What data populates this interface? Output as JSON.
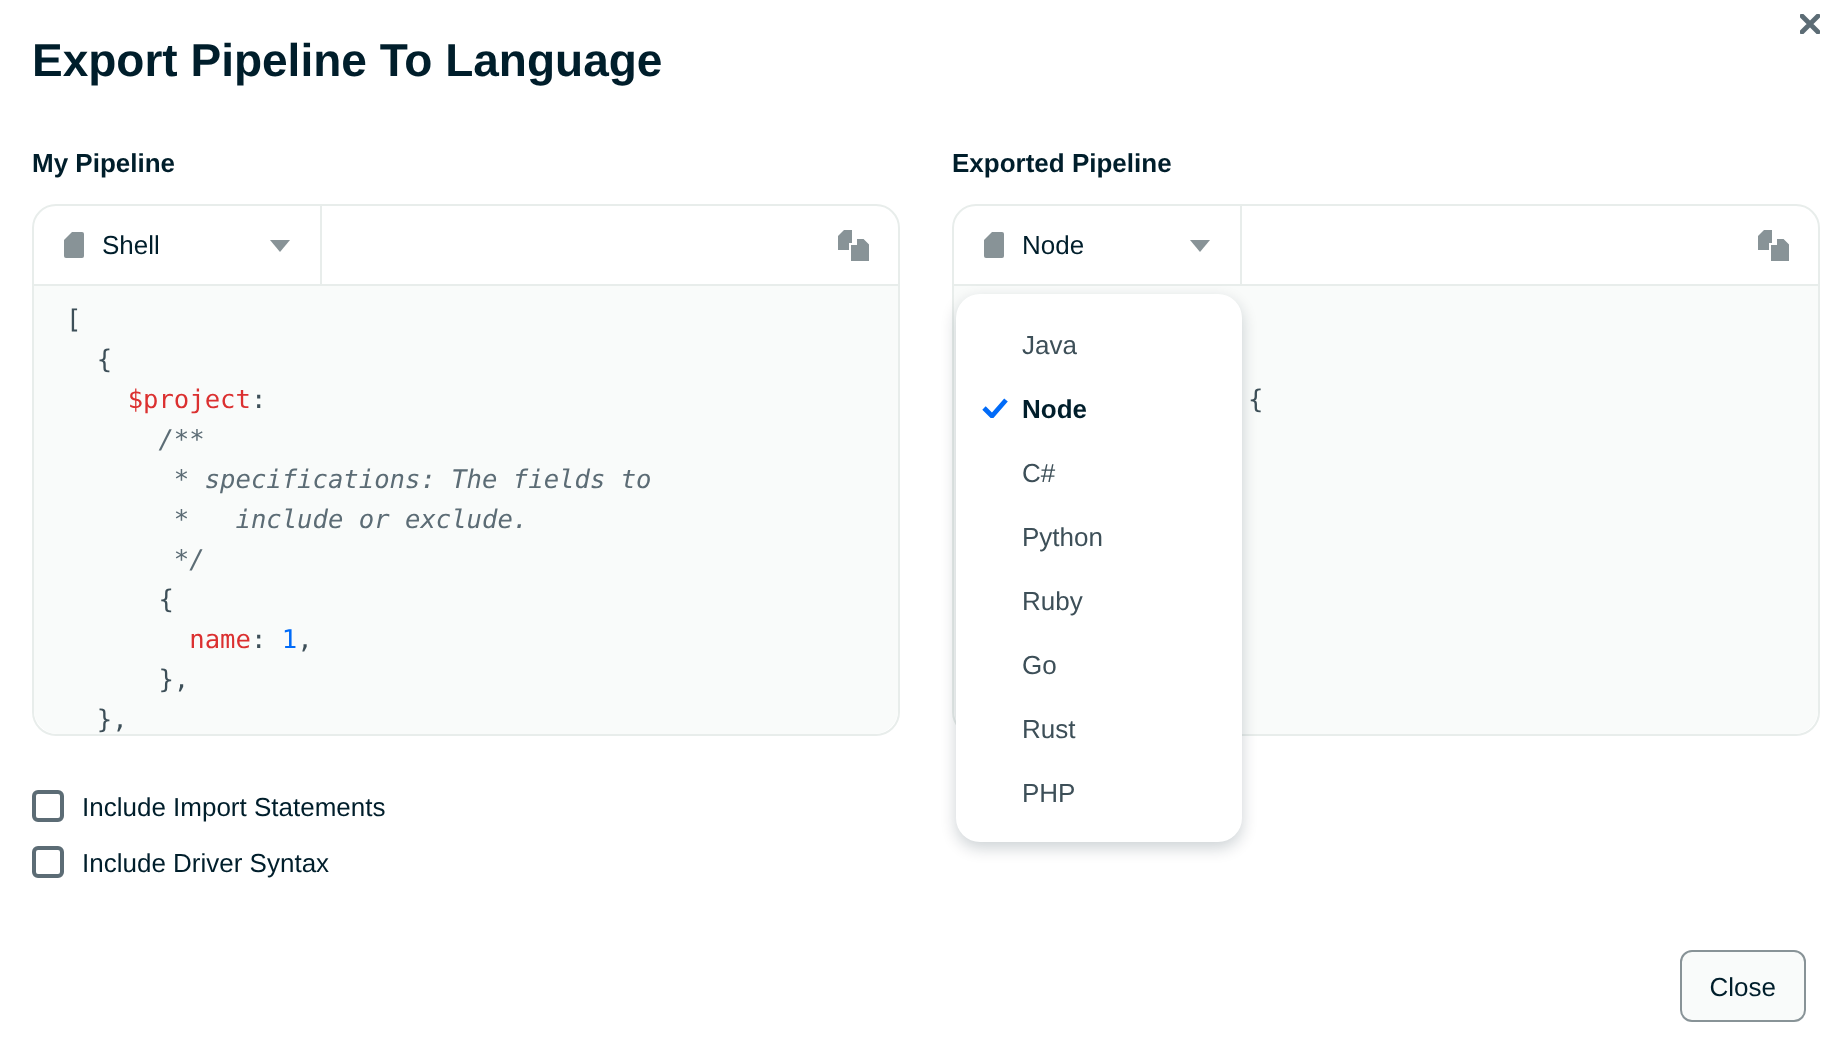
{
  "dialog": {
    "title": "Export Pipeline To Language"
  },
  "my_pipeline": {
    "label": "My Pipeline",
    "language": "Shell",
    "code": [
      {
        "tokens": [
          {
            "kind": "plain",
            "text": "["
          }
        ],
        "children": [
          {
            "tokens": [
              {
                "kind": "plain",
                "text": "{"
              }
            ],
            "children": [
              {
                "tokens": [
                  {
                    "kind": "key",
                    "text": "$project"
                  },
                  {
                    "kind": "plain",
                    "text": ":"
                  }
                ],
                "children": [
                  {
                    "tokens": [
                      {
                        "kind": "comment",
                        "text": "/**"
                      }
                    ]
                  },
                  {
                    "tokens": [
                      {
                        "kind": "comment",
                        "text": " * specifications: The fields to"
                      }
                    ]
                  },
                  {
                    "tokens": [
                      {
                        "kind": "comment",
                        "text": " *   include or exclude."
                      }
                    ]
                  },
                  {
                    "tokens": [
                      {
                        "kind": "comment",
                        "text": " */"
                      }
                    ]
                  },
                  {
                    "tokens": [
                      {
                        "kind": "plain",
                        "text": "{"
                      }
                    ],
                    "children": [
                      {
                        "tokens": [
                          {
                            "kind": "key",
                            "text": "name"
                          },
                          {
                            "kind": "plain",
                            "text": ": "
                          },
                          {
                            "kind": "number",
                            "text": "1"
                          },
                          {
                            "kind": "plain",
                            "text": ","
                          }
                        ]
                      }
                    ]
                  },
                  {
                    "tokens": [
                      {
                        "kind": "plain",
                        "text": "},"
                      }
                    ]
                  }
                ]
              }
            ]
          },
          {
            "tokens": [
              {
                "kind": "plain",
                "text": "},"
              }
            ]
          }
        ]
      }
    ]
  },
  "exported_pipeline": {
    "label": "Exported Pipeline",
    "language": "Node",
    "code": [
      {
        "tokens": [
          {
            "kind": "plain",
            "text": "{"
          }
        ]
      }
    ],
    "dropdown": {
      "expanded": true,
      "options": [
        {
          "label": "Java",
          "selected": false
        },
        {
          "label": "Node",
          "selected": true
        },
        {
          "label": "C#",
          "selected": false
        },
        {
          "label": "Python",
          "selected": false
        },
        {
          "label": "Ruby",
          "selected": false
        },
        {
          "label": "Go",
          "selected": false
        },
        {
          "label": "Rust",
          "selected": false
        },
        {
          "label": "PHP",
          "selected": false
        }
      ]
    }
  },
  "options": [
    {
      "label": "Include Import Statements",
      "checked": false
    },
    {
      "label": "Include Driver Syntax",
      "checked": false
    }
  ],
  "buttons": [
    {
      "label": "Close"
    }
  ]
}
